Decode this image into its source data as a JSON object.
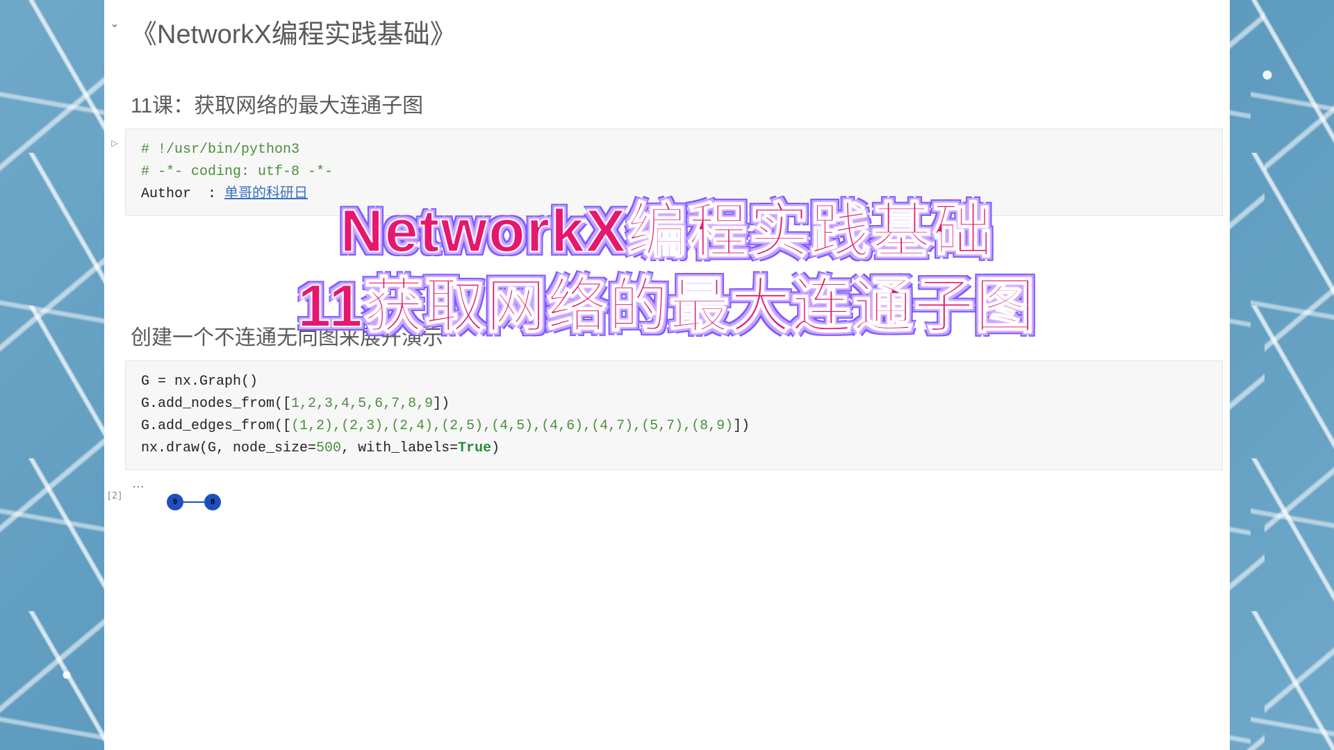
{
  "notebook": {
    "title": "《NetworkX编程实践基础》",
    "subtitle": "11课：获取网络的最大连通子图",
    "cell1": {
      "line1": "# !/usr/bin/python3",
      "line2": "# -*- coding: utf-8 -*-",
      "author_prefix": "Author  : ",
      "author_name": "单哥的科研日"
    },
    "section2_title": "创建一个不连通无向图来展开演示",
    "cell2_label": "[2]",
    "cell2": {
      "g_assign": "G = nx.Graph()",
      "nodes_call": "G.add_nodes_from([",
      "nodes_list": "1,2,3,4,5,6,7,8,9",
      "nodes_close": "])",
      "edges_call": "G.add_edges_from([",
      "edges_list": "(1,2),(2,3),(2,4),(2,5),(4,5),(4,6),(4,7),(5,7),(8,9)",
      "edges_close": "])",
      "draw_call_a": "nx.draw(G, node_size=",
      "draw_size": "500",
      "draw_call_b": ", with_labels=",
      "draw_true": "True",
      "draw_close": ")"
    }
  },
  "overlay": {
    "line1": "NetworkX编程实践基础",
    "line2": "11获取网络的最大连通子图"
  },
  "graph_peek": {
    "n1": "9",
    "n2": "8"
  },
  "ellipsis": "…"
}
